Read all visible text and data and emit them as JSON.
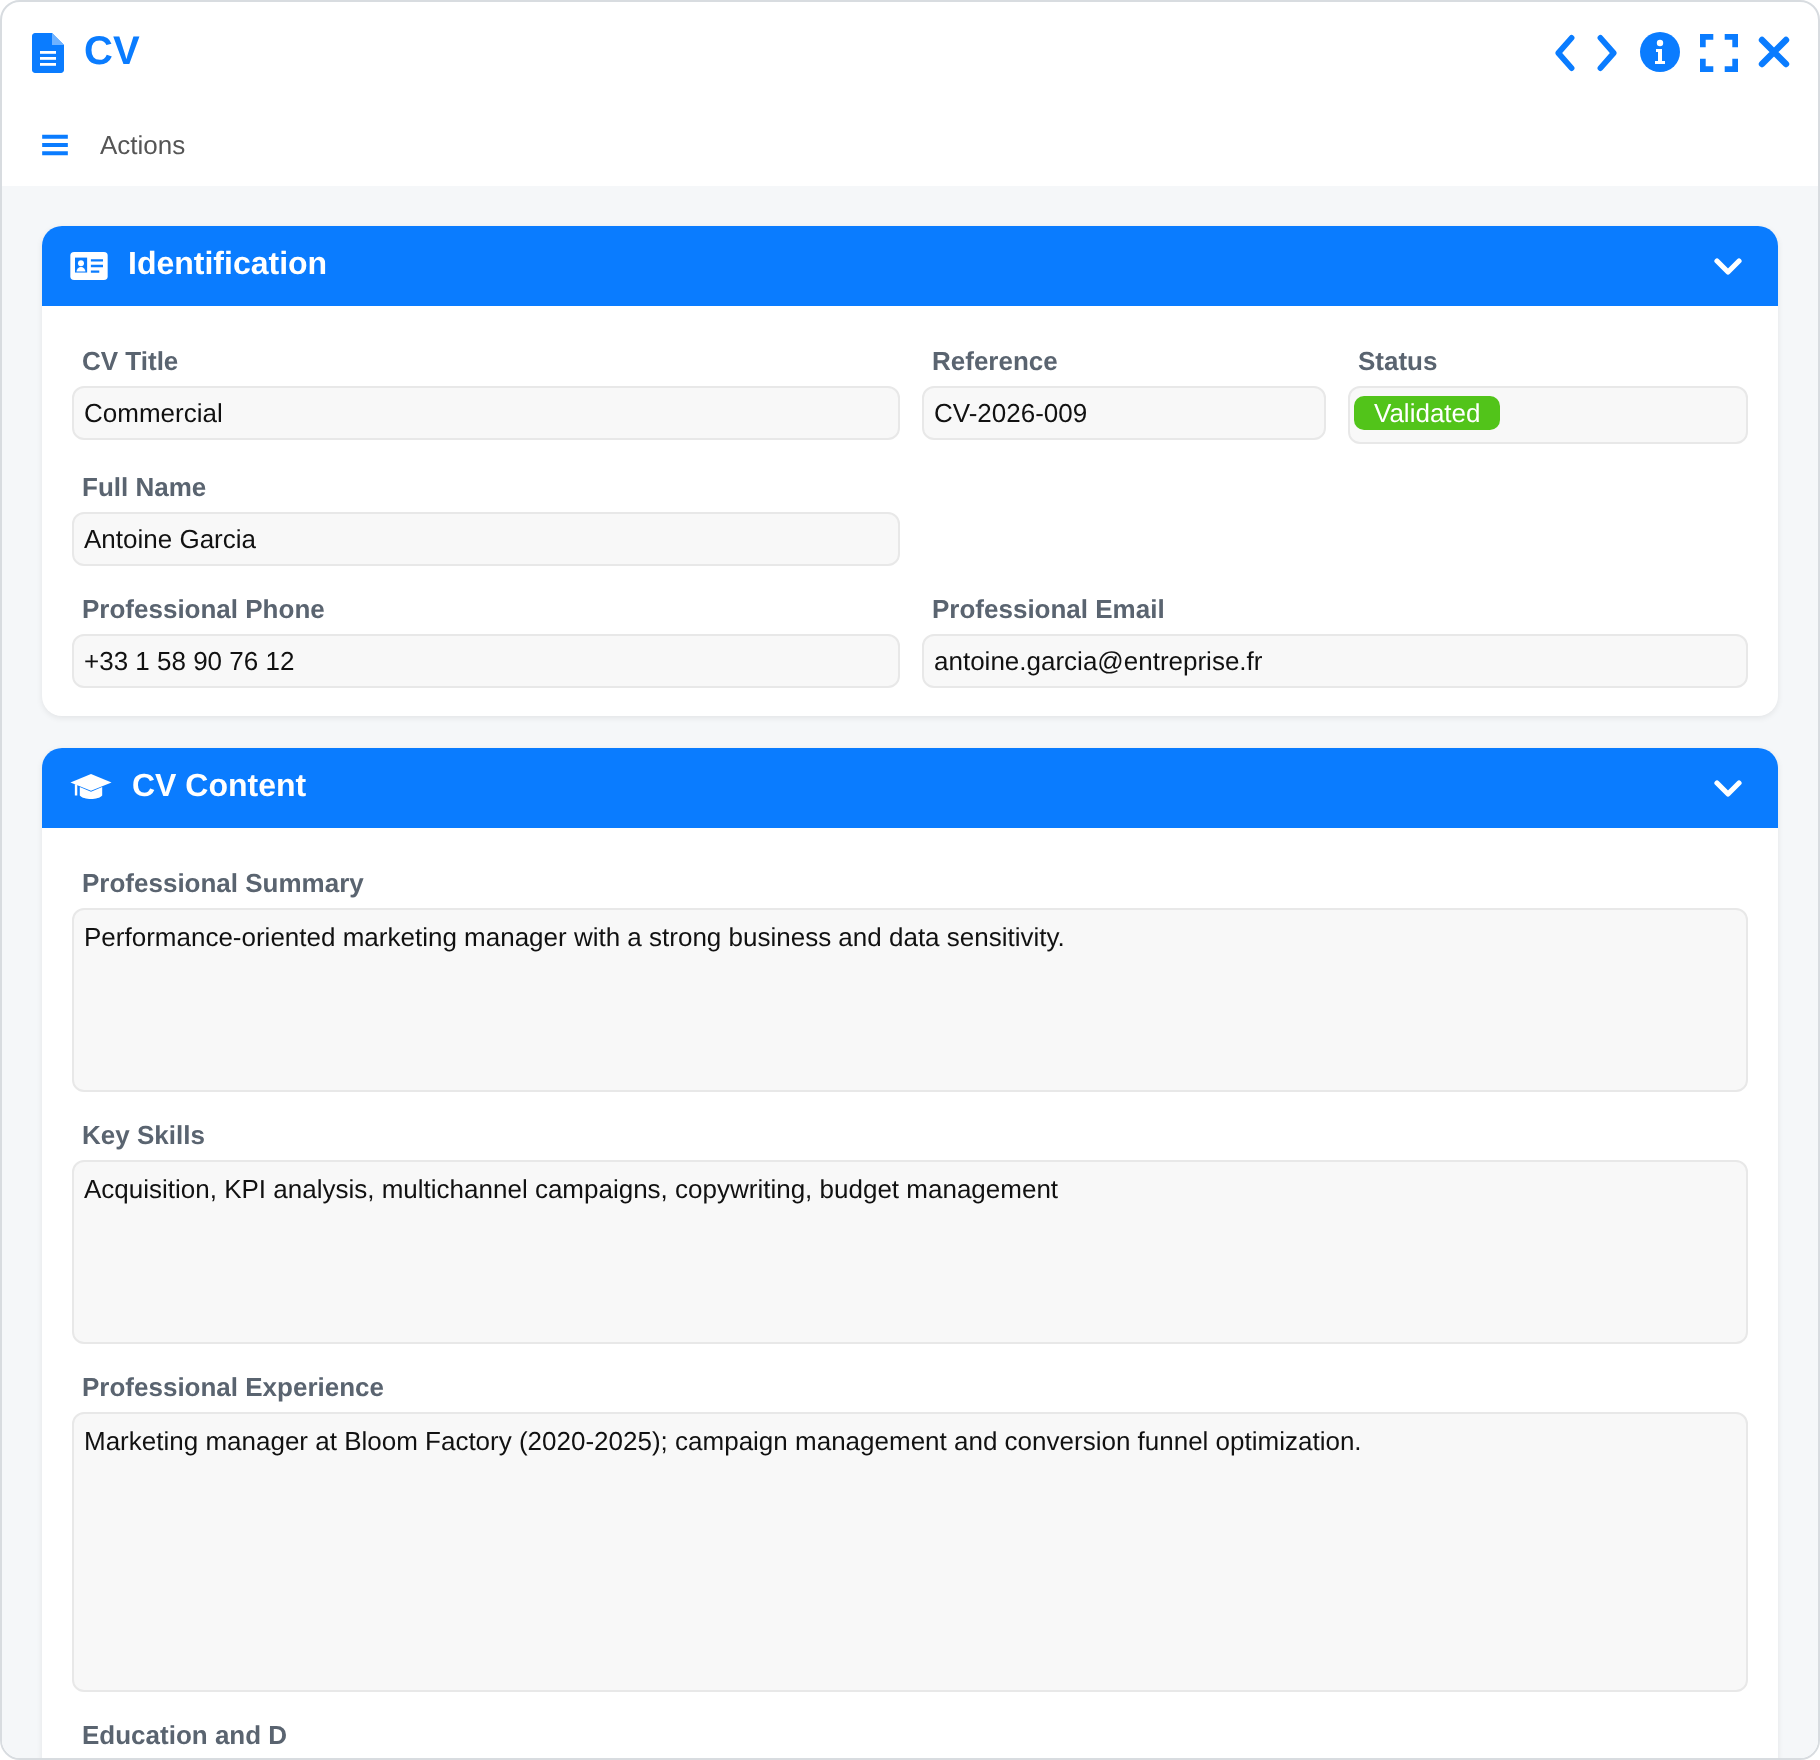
{
  "window": {
    "title": "CV"
  },
  "toolbar": {
    "menu_label": "Actions"
  },
  "sections": [
    {
      "title": "Identification",
      "expanded": true,
      "fields": [
        {
          "label": "CV Title",
          "kind": "text",
          "value": "Commercial"
        },
        {
          "label": "Reference",
          "kind": "text",
          "value": "CV-2026-009"
        },
        {
          "label": "Status",
          "kind": "badge",
          "value": "Validated",
          "color": "#52c41a"
        },
        {
          "label": "Full Name",
          "kind": "text",
          "value": "Antoine Garcia"
        },
        {
          "label": "Professional Phone",
          "kind": "text",
          "value": "+33 1 58 90 76 12"
        },
        {
          "label": "Professional Email",
          "kind": "text",
          "value": "antoine.garcia@entreprise.fr"
        }
      ]
    },
    {
      "title": "CV Content",
      "expanded": true,
      "fields": [
        {
          "label": "Professional Summary",
          "kind": "textarea",
          "value": "Performance-oriented marketing manager with a strong business and data sensitivity."
        },
        {
          "label": "Key Skills",
          "kind": "textarea",
          "value": "Acquisition, KPI analysis, multichannel campaigns, copywriting, budget management"
        },
        {
          "label": "Professional Experience",
          "kind": "textarea",
          "value": "Marketing manager at Bloom Factory (2020-2025); campaign management and conversion funnel optimization."
        },
        {
          "label": "Education and D",
          "kind": "label-only"
        }
      ]
    }
  ]
}
